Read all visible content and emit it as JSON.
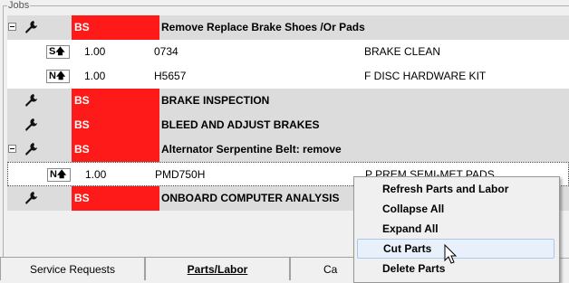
{
  "groupbox": {
    "title": "Jobs"
  },
  "jobs": [
    {
      "code": "BS",
      "description": "Remove  Replace Brake Shoes /Or Pads",
      "parts": [
        {
          "type": "S",
          "qty": "1.00",
          "part_number": "0734",
          "description": "BRAKE CLEAN"
        },
        {
          "type": "N",
          "qty": "1.00",
          "part_number": "H5657",
          "description": "F DISC HARDWARE KIT"
        }
      ]
    },
    {
      "code": "BS",
      "description": "BRAKE INSPECTION"
    },
    {
      "code": "BS",
      "description": "BLEED AND ADJUST BRAKES"
    },
    {
      "code": "BS",
      "description": "Alternator Serpentine Belt: remove",
      "parts": [
        {
          "type": "N",
          "qty": "1.00",
          "part_number": "PMD750H",
          "description": "P PREM SEMI-MET PADS"
        }
      ]
    },
    {
      "code": "BS",
      "description": "ONBOARD COMPUTER ANALYSIS"
    }
  ],
  "tabs": [
    {
      "label": "Service Requests"
    },
    {
      "label": "Parts/Labor"
    },
    {
      "label": "Ca"
    }
  ],
  "context_menu": {
    "items": [
      "Refresh Parts and Labor",
      "Collapse All",
      "Expand All",
      "Cut Parts",
      "Delete Parts"
    ],
    "highlighted": "Cut Parts"
  },
  "colors": {
    "job_code_bg": "#ff1a1a",
    "job_row_bg": "#dcdcdc",
    "menu_hover": "#e8f1fb"
  },
  "icons": {
    "job": "wrench-icon",
    "expander": "collapse-minus-icon",
    "part_type_arrow": "up-arrow-icon"
  }
}
